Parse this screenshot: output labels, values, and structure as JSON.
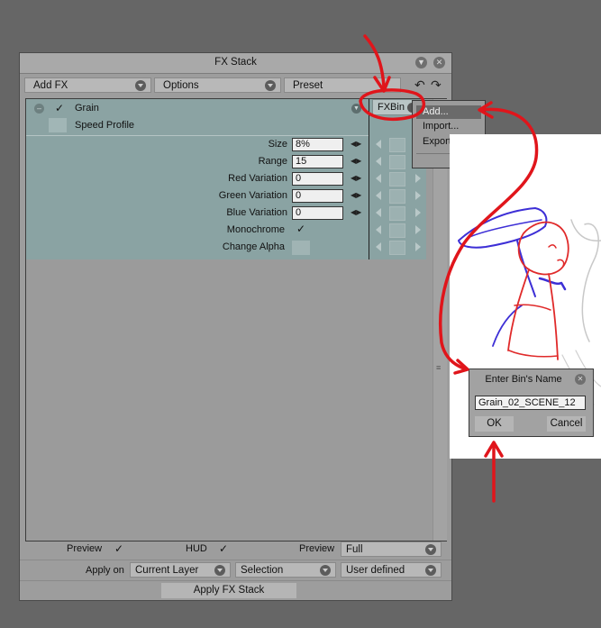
{
  "window": {
    "title": "FX Stack",
    "add_fx": "Add FX",
    "options": "Options",
    "preset": "Preset"
  },
  "effect": {
    "name": "Grain",
    "speed_profile": "Speed Profile",
    "fxbin": "FXBin",
    "params": [
      {
        "label": "Size",
        "value": "8%"
      },
      {
        "label": "Range",
        "value": "15"
      },
      {
        "label": "Red Variation",
        "value": "0"
      },
      {
        "label": "Green Variation",
        "value": "0"
      },
      {
        "label": "Blue Variation",
        "value": "0"
      }
    ],
    "monochrome": "Monochrome",
    "change_alpha": "Change Alpha"
  },
  "menu": {
    "items": [
      "Add...",
      "Import...",
      "Export..."
    ]
  },
  "footer": {
    "preview": "Preview",
    "hud": "HUD",
    "preview2": "Preview",
    "preview_value": "Full",
    "apply_on": "Apply on",
    "apply_layer": "Current Layer",
    "apply_selection": "Selection",
    "apply_user": "User defined",
    "apply_button": "Apply FX Stack"
  },
  "dialog": {
    "title": "Enter Bin's Name",
    "value": "Grain_02_SCENE_12",
    "ok": "OK",
    "cancel": "Cancel"
  },
  "colors": {
    "annotation": "#e0151b",
    "fx_panel": "#8aa3a3"
  }
}
